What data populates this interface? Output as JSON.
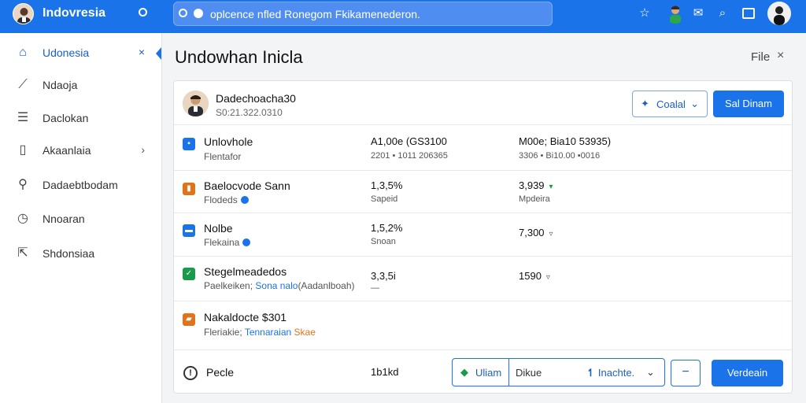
{
  "header": {
    "app_title": "Indovresia",
    "search_text": "oplcence nfled Ronegom Fkikamenederon.",
    "icons": [
      "star-icon",
      "user-avatar",
      "mail-icon",
      "search-icon",
      "window-icon",
      "profile-avatar"
    ]
  },
  "sidebar": {
    "items": [
      {
        "label": "Udonesia",
        "icon": "home-icon",
        "right": "×"
      },
      {
        "label": "Ndaoja",
        "icon": "trend-icon"
      },
      {
        "label": "Daclokan",
        "icon": "document-icon"
      },
      {
        "label": "Akaanlaia",
        "icon": "file-icon",
        "right": "›"
      },
      {
        "label": "Dadaebtbodam",
        "icon": "search-icon"
      },
      {
        "label": "Nnoaran",
        "icon": "clock-icon"
      },
      {
        "label": "Shdonsiaa",
        "icon": "share-icon"
      }
    ]
  },
  "main": {
    "title": "Undowhan Inicla",
    "file_label": "File",
    "close_label": "×"
  },
  "card": {
    "header": {
      "name": "Dadechoacha30",
      "sub": "S0:21.322.0310",
      "outline_button": "Coalal",
      "primary_button": "Sal Dinam"
    },
    "rows": [
      {
        "title": "Unlovhole",
        "sub": "Flentafor",
        "col2": "A1,00e (GS3100",
        "col2_sub": "2201 • 1011 206365",
        "col3": "M00e; Bia10 53935)",
        "col3_sub": "3306 • Bi10.00 •0016",
        "icon_color": "#1a73e8",
        "icon": "chat-icon"
      },
      {
        "title": "Baelocvode Sann",
        "sub": "Flodeds",
        "col2": "1,3,5%",
        "col2_sub": "Sapeid",
        "col3": "3,939",
        "col3_sub": "Mpdeira",
        "icon_color": "#e0741c",
        "icon": "bar-chart-icon",
        "trend_up": true
      },
      {
        "title": "Nolbe",
        "sub": "Flekaina",
        "col2": "1,5,2%",
        "col2_sub": "Snoan",
        "col3": "7,300",
        "icon_color": "#1a73e8",
        "icon": "mail-icon",
        "trend_down": true
      },
      {
        "title": "Stegelmeadedos",
        "sub_prefix": "Paelkeiken;",
        "sub_link": "Sona nalo",
        "sub_suffix": "(Aadanlboah)",
        "col2": "3,3,5i",
        "col2_sub": "—",
        "col3": "1590",
        "icon_color": "#1a9a4a",
        "icon": "check-icon",
        "trend_down": true
      },
      {
        "title": "Nakaldocte $301",
        "sub_prefix": "Fleriakie;",
        "sub_link": "Tennaraian",
        "sub_orange": "Skae",
        "icon_color": "#e0741c",
        "icon": "folder-icon"
      }
    ],
    "footer": {
      "label": "Pecle",
      "value": "1b1kd",
      "seg_tag": "Uliam",
      "seg_value": "Dikue",
      "seg_select": "Inachte.",
      "minus": "−",
      "submit": "Verdeain"
    }
  }
}
